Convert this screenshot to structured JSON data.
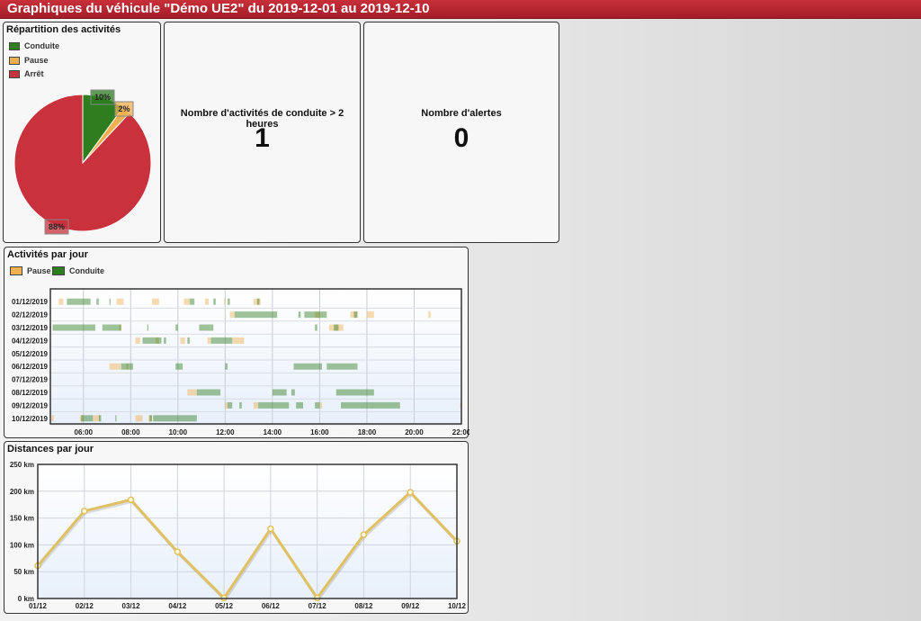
{
  "header": {
    "title": "Graphiques du véhicule \"Démo UE2\" du 2019-12-01 au 2019-12-10"
  },
  "colors": {
    "conduite": "#2e7d1f",
    "pause": "#f0b050",
    "arret": "#c9313c",
    "line": "#e0c060"
  },
  "pie_panel": {
    "title": "Répartition des activités",
    "legend": [
      "Conduite",
      "Pause",
      "Arrêt"
    ],
    "labels": [
      "10%",
      "2%",
      "88%"
    ]
  },
  "stats": [
    {
      "label": "Nombre d'activités de conduite > 2 heures",
      "value": "1"
    },
    {
      "label": "Nombre d'alertes",
      "value": "0"
    }
  ],
  "activities_panel": {
    "title": "Activités par jour",
    "legend": [
      "Pause",
      "Conduite"
    ]
  },
  "distances_panel": {
    "title": "Distances par jour"
  },
  "chart_data": [
    {
      "type": "pie",
      "title": "Répartition des activités",
      "categories": [
        "Conduite",
        "Pause",
        "Arrêt"
      ],
      "values": [
        10,
        2,
        88
      ],
      "data_labels": [
        "10%",
        "2%",
        "88%"
      ]
    },
    {
      "type": "bar",
      "title": "Activités par jour",
      "categories": [
        "01/12/2019",
        "02/12/2019",
        "03/12/2019",
        "04/12/2019",
        "05/12/2019",
        "06/12/2019",
        "07/12/2019",
        "08/12/2019",
        "09/12/2019",
        "10/12/2019"
      ],
      "x_ticks": [
        "06:00",
        "08:00",
        "10:00",
        "12:00",
        "14:00",
        "16:00",
        "18:00",
        "20:00",
        "22:00"
      ],
      "xlim": [
        4.6,
        22.0
      ],
      "series": [
        {
          "name": "Pause",
          "intervals": [
            [
              [
                4.95,
                5.15
              ],
              [
                7.4,
                7.7
              ],
              [
                8.9,
                9.2
              ],
              [
                10.25,
                10.5
              ],
              [
                11.15,
                11.3
              ],
              [
                11.95,
                12.0
              ],
              [
                13.2,
                13.5
              ]
            ],
            [
              [
                12.2,
                12.4
              ],
              [
                15.8,
                16.0
              ],
              [
                17.3,
                17.6
              ],
              [
                18.0,
                18.3
              ],
              [
                20.6,
                20.7
              ]
            ],
            [
              [
                7.5,
                7.6
              ],
              [
                16.4,
                17.0
              ]
            ],
            [
              [
                8.2,
                8.4
              ],
              [
                9.05,
                9.2
              ],
              [
                10.1,
                10.3
              ],
              [
                11.25,
                11.4
              ],
              [
                12.3,
                12.8
              ]
            ],
            [],
            [
              [
                7.1,
                7.6
              ],
              [
                7.8,
                7.9
              ]
            ],
            [],
            [
              [
                10.4,
                10.8
              ]
            ],
            [
              [
                12.0,
                12.1
              ],
              [
                13.2,
                13.4
              ],
              [
                16.0,
                16.1
              ],
              [
                21.95,
                22.0
              ]
            ],
            [
              [
                4.65,
                4.75
              ],
              [
                5.85,
                6.0
              ],
              [
                6.4,
                6.7
              ],
              [
                8.2,
                8.5
              ],
              [
                8.75,
                8.9
              ]
            ]
          ]
        },
        {
          "name": "Conduite",
          "intervals": [
            [
              [
                5.3,
                6.3
              ],
              [
                6.55,
                6.65
              ],
              [
                7.1,
                7.15
              ],
              [
                10.5,
                10.7
              ],
              [
                11.5,
                11.6
              ],
              [
                12.1,
                12.2
              ],
              [
                13.35,
                13.45
              ]
            ],
            [
              [
                12.4,
                14.2
              ],
              [
                15.1,
                15.2
              ],
              [
                15.35,
                16.3
              ],
              [
                17.45,
                17.6
              ]
            ],
            [
              [
                4.7,
                6.5
              ],
              [
                6.8,
                7.6
              ],
              [
                8.7,
                8.75
              ],
              [
                9.9,
                10.0
              ],
              [
                10.9,
                11.5
              ],
              [
                15.8,
                15.9
              ],
              [
                16.6,
                16.8
              ]
            ],
            [
              [
                8.5,
                9.3
              ],
              [
                9.4,
                9.5
              ],
              [
                10.4,
                10.5
              ],
              [
                11.4,
                12.3
              ]
            ],
            [],
            [
              [
                7.6,
                8.1
              ],
              [
                9.9,
                10.2
              ],
              [
                12.0,
                12.1
              ],
              [
                14.9,
                16.1
              ],
              [
                16.3,
                17.6
              ]
            ],
            [],
            [
              [
                10.8,
                11.8
              ],
              [
                14.0,
                14.6
              ],
              [
                14.8,
                14.95
              ],
              [
                16.7,
                18.3
              ]
            ],
            [
              [
                12.1,
                12.3
              ],
              [
                12.6,
                12.7
              ],
              [
                13.4,
                14.7
              ],
              [
                15.0,
                15.3
              ],
              [
                15.8,
                16.0
              ],
              [
                16.9,
                19.3
              ],
              [
                19.3,
                19.4
              ]
            ],
            [
              [
                5.9,
                6.4
              ],
              [
                6.65,
                6.75
              ],
              [
                7.35,
                7.4
              ],
              [
                8.8,
                8.9
              ],
              [
                8.95,
                9.9
              ],
              [
                9.9,
                10.8
              ]
            ]
          ]
        }
      ]
    },
    {
      "type": "line",
      "title": "Distances par jour",
      "x": [
        "01/12",
        "02/12",
        "03/12",
        "04/12",
        "05/12",
        "06/12",
        "07/12",
        "08/12",
        "09/12",
        "10/12"
      ],
      "y_ticks": [
        "0 km",
        "50 km",
        "100 km",
        "150 km",
        "200 km",
        "250 km"
      ],
      "ylim": [
        0,
        250
      ],
      "series": [
        {
          "values": [
            61,
            163,
            184,
            87,
            1,
            130,
            1,
            119,
            198,
            107
          ]
        }
      ]
    }
  ]
}
